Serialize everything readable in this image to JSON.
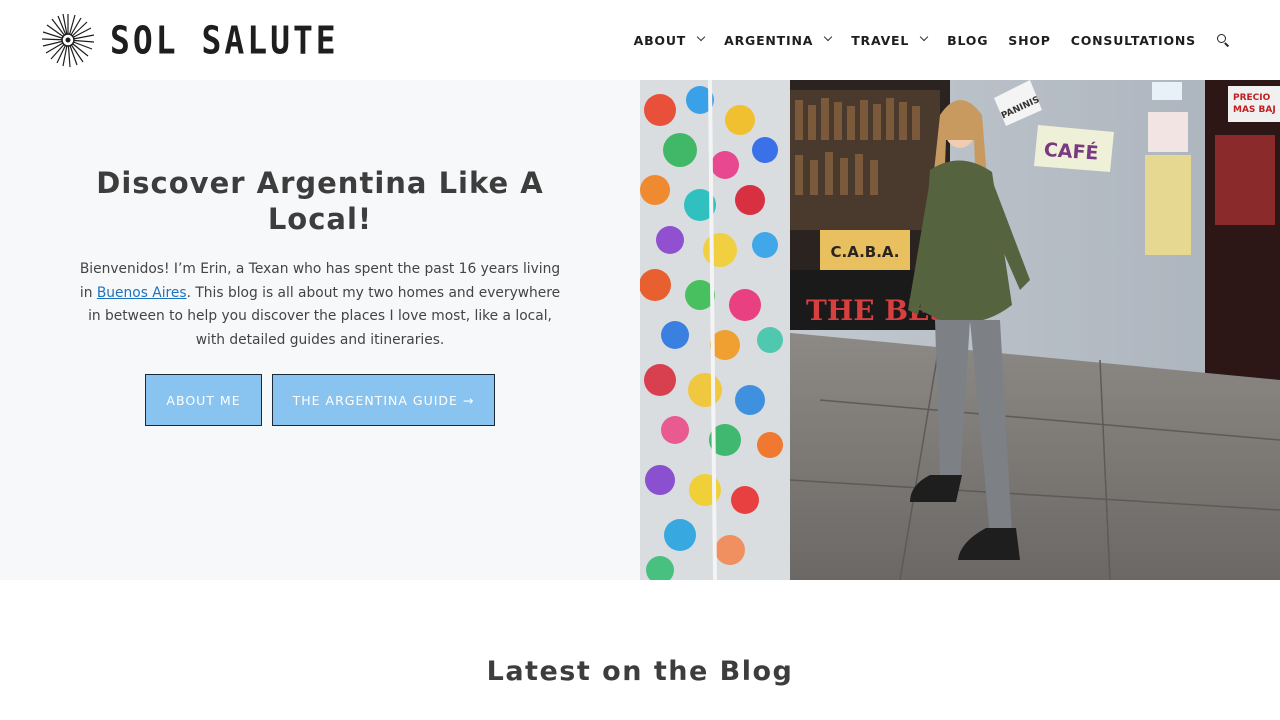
{
  "site": {
    "logo_text": "SOL SALUTE"
  },
  "nav": {
    "items": [
      {
        "label": "ABOUT",
        "dropdown": true
      },
      {
        "label": "ARGENTINA",
        "dropdown": true
      },
      {
        "label": "TRAVEL",
        "dropdown": true
      },
      {
        "label": "BLOG",
        "dropdown": false
      },
      {
        "label": "SHOP",
        "dropdown": false
      },
      {
        "label": "CONSULTATIONS",
        "dropdown": false
      }
    ],
    "search_icon": "search-icon"
  },
  "hero": {
    "title": "Discover Argentina Like A Local!",
    "text_before_link": "Bienvenidos! I’m Erin, a Texan who has spent the past 16 years living in ",
    "link_text": "Buenos Aires",
    "text_after_link": ". This blog is all about my two homes and everywhere in between to help you discover the places I love most, like a local, with detailed guides and itineraries.",
    "button_about": "ABOUT ME",
    "button_guide": "THE ARGENTINA GUIDE →",
    "photo_signs": {
      "cafe": "CAFÉ",
      "the_best": "THE BEST",
      "caba": "C.A.B.A.",
      "paninis": "PANINIS",
      "precio": "PRECIO",
      "mas_bajo": "MAS BAJ"
    }
  },
  "blog": {
    "heading": "Latest on the Blog"
  },
  "colors": {
    "button_bg": "#89c4f0",
    "link": "#1e73be",
    "hero_bg": "#f7f8f9",
    "heading": "#3d3d3d"
  }
}
